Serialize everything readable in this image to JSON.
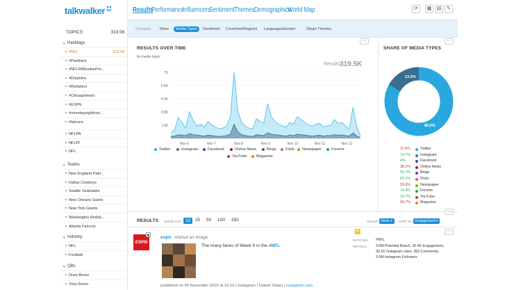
{
  "brand": {
    "name": "talkwalker",
    "color": "#1a8fd8"
  },
  "topnav": {
    "tabs": [
      "Results",
      "Performance",
      "Influencers",
      "Sentiment",
      "Themes",
      "Demographics",
      "World Map"
    ],
    "active": "Results",
    "tools": [
      "refresh-icon",
      "layout-icon",
      "grid-icon",
      "bookmark-icon"
    ]
  },
  "subnav": {
    "compare": "Compare",
    "items": [
      "None",
      "Media Types",
      "Sentiment",
      "Countries/Regions",
      "Languages",
      "Gender",
      "Smart Themes"
    ],
    "active": "Media Types"
  },
  "sidebar": {
    "topics_label": "TOPICS",
    "topics_count": "319.5K",
    "hashtags_title": "Hashtags",
    "hashtags": [
      {
        "label": "#NFL",
        "count": "319.5K",
        "active": true
      },
      {
        "label": "#Panthers",
        "count": ""
      },
      {
        "label": "#NFLPARookiePre...",
        "count": ""
      },
      {
        "label": "#Dolphins",
        "count": ""
      },
      {
        "label": "#Redskins",
        "count": ""
      },
      {
        "label": "#Chicagobears",
        "count": ""
      },
      {
        "label": "#ESPN",
        "count": ""
      },
      {
        "label": "#mondaynightfoot...",
        "count": ""
      },
      {
        "label": "#falcons",
        "count": ""
      }
    ],
    "plain": [
      "NFLPA",
      "NFLPI",
      "NFL"
    ],
    "teams_title": "Teams",
    "teams": [
      "New England Patri...",
      "Dallas Cowboys",
      "Seattle Seahawks",
      "New Orleans Saints",
      "New York Giants",
      "Washington Redsk...",
      "Atlanta Falcons"
    ],
    "industry_title": "Industry",
    "industry": [
      "NFL",
      "Football"
    ],
    "qbs_title": "QBs",
    "qbs": [
      "Drew Brees",
      "Tony Romo"
    ]
  },
  "results_over_time": {
    "title": "RESULTS OVER TIME",
    "subtitle": "by media types",
    "results_label": "Results",
    "results_value": "319.5K",
    "legend": [
      "Twitter",
      "Instagram",
      "Facebook",
      "Online News",
      "Blogs",
      "Flickr",
      "Newspaper",
      "Forums",
      "YouTube",
      "Magazine"
    ]
  },
  "share": {
    "title": "SHARE OF MEDIA TYPES",
    "inner_label": "13.3%",
    "main_label": "86.6%",
    "rows": [
      {
        "pct": "11.6%",
        "name": "Twitter",
        "color": "#29a8e0"
      },
      {
        "pct": "14.7%",
        "name": "Instagram",
        "color": "#3a6e8f"
      },
      {
        "pct": "4%",
        "name": "Facebook",
        "color": "#2d4a9a"
      },
      {
        "pct": "38.1%",
        "name": "Online News",
        "color": "#8b1a3a"
      },
      {
        "pct": "55.2%",
        "name": "Blogs",
        "color": "#6a3d9a"
      },
      {
        "pct": "65.1%",
        "name": "Flickr",
        "color": "#d94c9b"
      },
      {
        "pct": "55.6%",
        "name": "Newspaper",
        "color": "#7fb800"
      },
      {
        "pct": "74.4%",
        "name": "Forums",
        "color": "#16a085"
      },
      {
        "pct": "16.7%",
        "name": "YouTube",
        "color": "#c0392b"
      },
      {
        "pct": "66.7%",
        "name": "Magazine",
        "color": "#e67e22"
      }
    ]
  },
  "results": {
    "title": "RESULTS",
    "show_top": "SHOW TOP",
    "options": [
      "10",
      "25",
      "50",
      "100",
      "250"
    ],
    "active": "10",
    "group_label": "GROUP",
    "group_value": "None",
    "sort_label": "SORT BY",
    "sort_value": "Engagement"
  },
  "post": {
    "author": "espn",
    "action": "shared an image",
    "text_prefix": "The many faces of Week 9 in the ",
    "hashtag": "#NFL",
    "footer_prefix": "published on 09 November 2015 at 10:16 | Instagram | United States | ",
    "footer_link": "instagram.com",
    "matches_label": "MATCHES",
    "metrics_label": "METRICS",
    "matches_value": "#NFL",
    "metrics": [
      "3.0M Potential Reach, 30.4K Engagement,",
      "30.1K Instagram Likes, 362 Comments,",
      "3.0M Instagram Followers"
    ]
  },
  "chart_data": {
    "type": "area",
    "x": [
      "Nov 6",
      "Nov 7",
      "Nov 8",
      "Nov 9",
      "Nov 10",
      "Nov 11",
      "Nov 12"
    ],
    "yticks": [
      "1.4K",
      "2.8K",
      "4.2K",
      "5.6K",
      "7K"
    ],
    "ylim": [
      0,
      7000
    ],
    "series": [
      {
        "name": "Twitter",
        "color": "#5bc6ea",
        "values": [
          600,
          900,
          2200,
          1700,
          1100,
          2800,
          1900,
          1300,
          1500,
          1200,
          1800,
          1400,
          1200,
          1000,
          1100,
          1300,
          2300,
          7000,
          2900,
          1700,
          1300,
          1100,
          1000,
          2100,
          1800,
          1600,
          3700,
          2300,
          1800,
          1500,
          1300,
          1200,
          1700,
          1500,
          2300,
          2000,
          1700,
          1400,
          1300,
          1500,
          1600,
          1200,
          1300,
          1400,
          2000,
          1600,
          1700,
          1300,
          1000,
          3300,
          1200,
          300
        ]
      },
      {
        "name": "Instagram",
        "color": "#3a6e8f",
        "values": [
          200,
          250,
          400,
          350,
          300,
          500,
          400,
          350,
          300,
          250,
          350,
          300,
          250,
          200,
          250,
          300,
          450,
          1500,
          700,
          400,
          300,
          250,
          200,
          400,
          350,
          300,
          600,
          450,
          400,
          350,
          300,
          250,
          350,
          300,
          450,
          400,
          350,
          300,
          250,
          300,
          350,
          250,
          300,
          300,
          400,
          350,
          350,
          300,
          250,
          600,
          250,
          80
        ]
      }
    ]
  }
}
